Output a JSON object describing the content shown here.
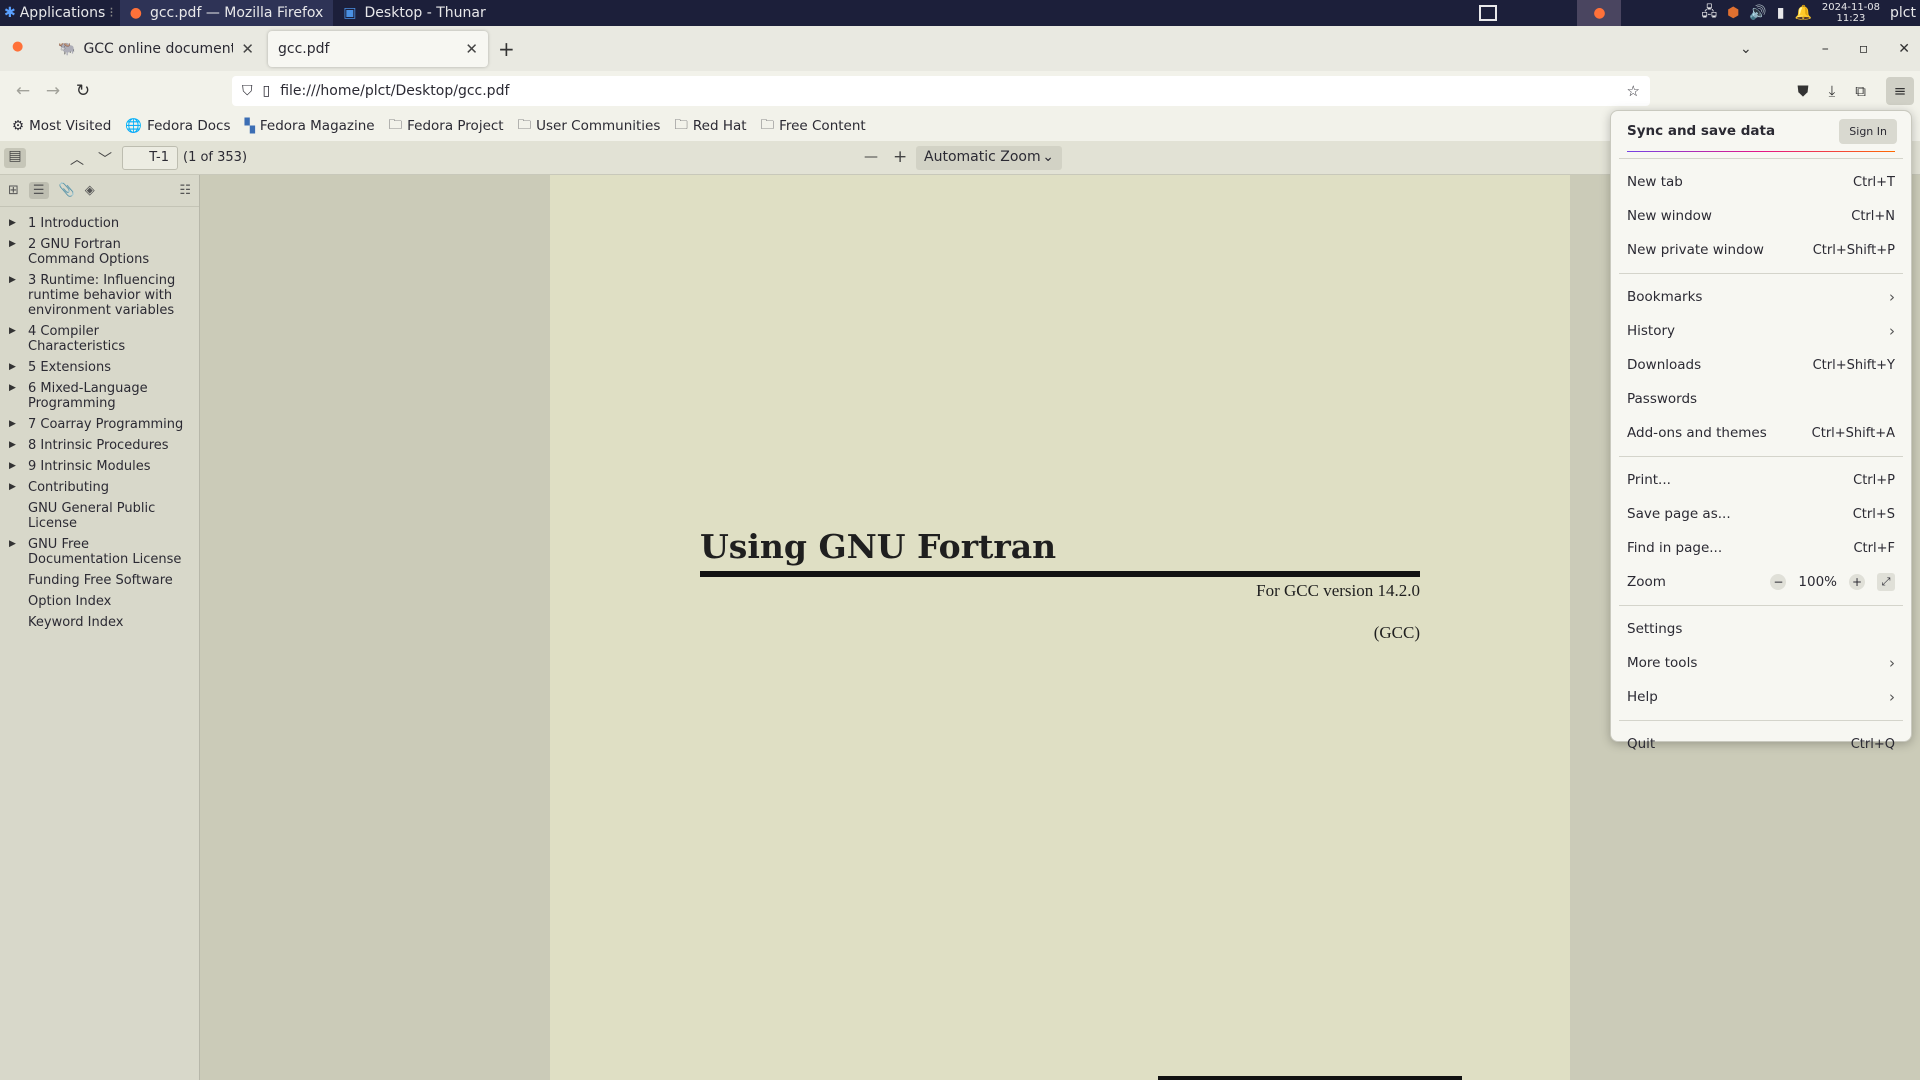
{
  "panel": {
    "applications": "Applications",
    "tasks": [
      {
        "label": "gcc.pdf — Mozilla Firefox",
        "active": true
      },
      {
        "label": "Desktop - Thunar",
        "active": false
      }
    ],
    "date": "2024-11-08",
    "time": "11:23",
    "user": "plct"
  },
  "tabs": [
    {
      "title": "GCC online documentation",
      "active": false
    },
    {
      "title": "gcc.pdf",
      "active": true
    }
  ],
  "url": "file:///home/plct/Desktop/gcc.pdf",
  "bookmarks": [
    {
      "label": "Most Visited",
      "icon": "gear-icon"
    },
    {
      "label": "Fedora Docs",
      "icon": "globe-icon"
    },
    {
      "label": "Fedora Magazine",
      "icon": "fedora-magazine-icon"
    },
    {
      "label": "Fedora Project",
      "icon": "folder-icon"
    },
    {
      "label": "User Communities",
      "icon": "folder-icon"
    },
    {
      "label": "Red Hat",
      "icon": "folder-icon"
    },
    {
      "label": "Free Content",
      "icon": "folder-icon"
    }
  ],
  "pdf_toolbar": {
    "page_number": "T-1",
    "page_count": "(1 of 353)",
    "zoom": "Automatic Zoom"
  },
  "outline": [
    {
      "label": "1 Introduction",
      "expandable": true
    },
    {
      "label": "2 GNU Fortran Command Options",
      "expandable": true
    },
    {
      "label": "3 Runtime: Influencing runtime behavior with environment variables",
      "expandable": true
    },
    {
      "label": "4 Compiler Characteristics",
      "expandable": true
    },
    {
      "label": "5 Extensions",
      "expandable": true
    },
    {
      "label": "6 Mixed-Language Programming",
      "expandable": true
    },
    {
      "label": "7 Coarray Programming",
      "expandable": true
    },
    {
      "label": "8 Intrinsic Procedures",
      "expandable": true
    },
    {
      "label": "9 Intrinsic Modules",
      "expandable": true
    },
    {
      "label": "Contributing",
      "expandable": true
    },
    {
      "label": "GNU General Public License",
      "expandable": false
    },
    {
      "label": "GNU Free Documentation License",
      "expandable": true
    },
    {
      "label": "Funding Free Software",
      "expandable": false
    },
    {
      "label": "Option Index",
      "expandable": false
    },
    {
      "label": "Keyword Index",
      "expandable": false
    }
  ],
  "document": {
    "title": "Using GNU Fortran",
    "subtitle": "For GCC version 14.2.0",
    "publisher": "(GCC)"
  },
  "app_menu": {
    "sync_label": "Sync and save data",
    "sign_in": "Sign In",
    "groups": [
      [
        {
          "label": "New tab",
          "shortcut": "Ctrl+T"
        },
        {
          "label": "New window",
          "shortcut": "Ctrl+N"
        },
        {
          "label": "New private window",
          "shortcut": "Ctrl+Shift+P"
        }
      ],
      [
        {
          "label": "Bookmarks",
          "submenu": true
        },
        {
          "label": "History",
          "submenu": true
        },
        {
          "label": "Downloads",
          "shortcut": "Ctrl+Shift+Y"
        },
        {
          "label": "Passwords"
        },
        {
          "label": "Add-ons and themes",
          "shortcut": "Ctrl+Shift+A"
        }
      ],
      [
        {
          "label": "Print...",
          "shortcut": "Ctrl+P"
        },
        {
          "label": "Save page as...",
          "shortcut": "Ctrl+S"
        },
        {
          "label": "Find in page...",
          "shortcut": "Ctrl+F"
        },
        {
          "label": "Zoom",
          "zoom": "100%"
        }
      ],
      [
        {
          "label": "Settings"
        },
        {
          "label": "More tools",
          "submenu": true
        },
        {
          "label": "Help",
          "submenu": true
        }
      ],
      [
        {
          "label": "Quit",
          "shortcut": "Ctrl+Q"
        }
      ]
    ]
  }
}
